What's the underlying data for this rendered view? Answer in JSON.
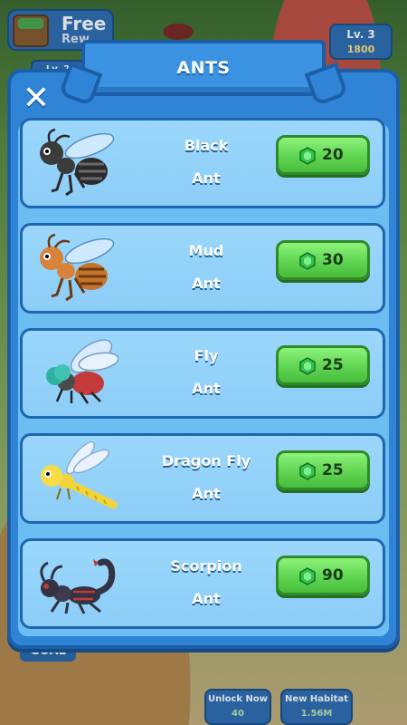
{
  "background": {
    "reward_title": "Free",
    "reward_sub": "Rew",
    "level_label": "Lv. 3",
    "level_coins": "1800",
    "level_small": "Lv. 2",
    "goal_label": "GOAL",
    "unlock_label": "Unlock Now",
    "unlock_value": "40",
    "habitat_label": "New Habitat",
    "habitat_value": "1.56M"
  },
  "modal": {
    "title": "ANTS",
    "close_label": "✕"
  },
  "ants": [
    {
      "name_line1": "Black",
      "name_line2": "Ant",
      "price": "20",
      "icon": "black-ant-icon",
      "body_color": "#3b3b3b",
      "stripe_color": "#202020"
    },
    {
      "name_line1": "Mud",
      "name_line2": "Ant",
      "price": "30",
      "icon": "mud-ant-icon",
      "body_color": "#c6742b",
      "stripe_color": "#6b3a12"
    },
    {
      "name_line1": "Fly",
      "name_line2": "Ant",
      "price": "25",
      "icon": "fly-ant-icon",
      "body_color": "#c23a3a",
      "stripe_color": "#5a1a1a"
    },
    {
      "name_line1": "Dragon Fly",
      "name_line2": "Ant",
      "price": "25",
      "icon": "dragonfly-ant-icon",
      "body_color": "#f2d43a",
      "stripe_color": "#c9a41e"
    },
    {
      "name_line1": "Scorpion",
      "name_line2": "Ant",
      "price": "90",
      "icon": "scorpion-ant-icon",
      "body_color": "#333344",
      "stripe_color": "#c23a3a"
    }
  ],
  "colors": {
    "gem": "#2fc44a",
    "price_button": "#5fd552",
    "panel": "#2f84d6"
  }
}
